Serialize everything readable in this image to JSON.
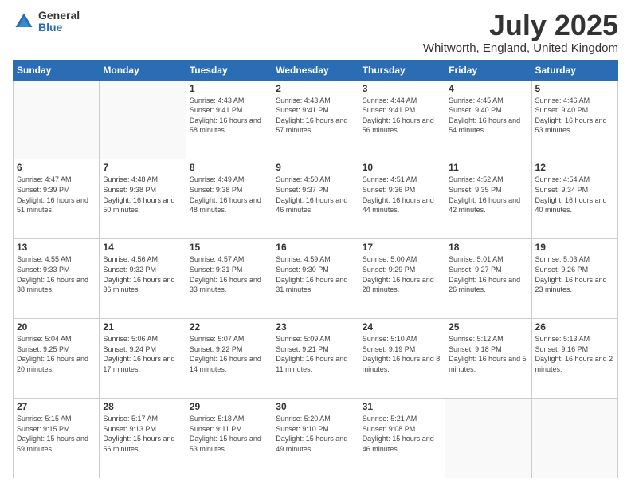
{
  "logo": {
    "general": "General",
    "blue": "Blue"
  },
  "title": "July 2025",
  "subtitle": "Whitworth, England, United Kingdom",
  "headers": [
    "Sunday",
    "Monday",
    "Tuesday",
    "Wednesday",
    "Thursday",
    "Friday",
    "Saturday"
  ],
  "weeks": [
    [
      {
        "day": "",
        "sunrise": "",
        "sunset": "",
        "daylight": ""
      },
      {
        "day": "",
        "sunrise": "",
        "sunset": "",
        "daylight": ""
      },
      {
        "day": "1",
        "sunrise": "Sunrise: 4:43 AM",
        "sunset": "Sunset: 9:41 PM",
        "daylight": "Daylight: 16 hours and 58 minutes."
      },
      {
        "day": "2",
        "sunrise": "Sunrise: 4:43 AM",
        "sunset": "Sunset: 9:41 PM",
        "daylight": "Daylight: 16 hours and 57 minutes."
      },
      {
        "day": "3",
        "sunrise": "Sunrise: 4:44 AM",
        "sunset": "Sunset: 9:41 PM",
        "daylight": "Daylight: 16 hours and 56 minutes."
      },
      {
        "day": "4",
        "sunrise": "Sunrise: 4:45 AM",
        "sunset": "Sunset: 9:40 PM",
        "daylight": "Daylight: 16 hours and 54 minutes."
      },
      {
        "day": "5",
        "sunrise": "Sunrise: 4:46 AM",
        "sunset": "Sunset: 9:40 PM",
        "daylight": "Daylight: 16 hours and 53 minutes."
      }
    ],
    [
      {
        "day": "6",
        "sunrise": "Sunrise: 4:47 AM",
        "sunset": "Sunset: 9:39 PM",
        "daylight": "Daylight: 16 hours and 51 minutes."
      },
      {
        "day": "7",
        "sunrise": "Sunrise: 4:48 AM",
        "sunset": "Sunset: 9:38 PM",
        "daylight": "Daylight: 16 hours and 50 minutes."
      },
      {
        "day": "8",
        "sunrise": "Sunrise: 4:49 AM",
        "sunset": "Sunset: 9:38 PM",
        "daylight": "Daylight: 16 hours and 48 minutes."
      },
      {
        "day": "9",
        "sunrise": "Sunrise: 4:50 AM",
        "sunset": "Sunset: 9:37 PM",
        "daylight": "Daylight: 16 hours and 46 minutes."
      },
      {
        "day": "10",
        "sunrise": "Sunrise: 4:51 AM",
        "sunset": "Sunset: 9:36 PM",
        "daylight": "Daylight: 16 hours and 44 minutes."
      },
      {
        "day": "11",
        "sunrise": "Sunrise: 4:52 AM",
        "sunset": "Sunset: 9:35 PM",
        "daylight": "Daylight: 16 hours and 42 minutes."
      },
      {
        "day": "12",
        "sunrise": "Sunrise: 4:54 AM",
        "sunset": "Sunset: 9:34 PM",
        "daylight": "Daylight: 16 hours and 40 minutes."
      }
    ],
    [
      {
        "day": "13",
        "sunrise": "Sunrise: 4:55 AM",
        "sunset": "Sunset: 9:33 PM",
        "daylight": "Daylight: 16 hours and 38 minutes."
      },
      {
        "day": "14",
        "sunrise": "Sunrise: 4:56 AM",
        "sunset": "Sunset: 9:32 PM",
        "daylight": "Daylight: 16 hours and 36 minutes."
      },
      {
        "day": "15",
        "sunrise": "Sunrise: 4:57 AM",
        "sunset": "Sunset: 9:31 PM",
        "daylight": "Daylight: 16 hours and 33 minutes."
      },
      {
        "day": "16",
        "sunrise": "Sunrise: 4:59 AM",
        "sunset": "Sunset: 9:30 PM",
        "daylight": "Daylight: 16 hours and 31 minutes."
      },
      {
        "day": "17",
        "sunrise": "Sunrise: 5:00 AM",
        "sunset": "Sunset: 9:29 PM",
        "daylight": "Daylight: 16 hours and 28 minutes."
      },
      {
        "day": "18",
        "sunrise": "Sunrise: 5:01 AM",
        "sunset": "Sunset: 9:27 PM",
        "daylight": "Daylight: 16 hours and 26 minutes."
      },
      {
        "day": "19",
        "sunrise": "Sunrise: 5:03 AM",
        "sunset": "Sunset: 9:26 PM",
        "daylight": "Daylight: 16 hours and 23 minutes."
      }
    ],
    [
      {
        "day": "20",
        "sunrise": "Sunrise: 5:04 AM",
        "sunset": "Sunset: 9:25 PM",
        "daylight": "Daylight: 16 hours and 20 minutes."
      },
      {
        "day": "21",
        "sunrise": "Sunrise: 5:06 AM",
        "sunset": "Sunset: 9:24 PM",
        "daylight": "Daylight: 16 hours and 17 minutes."
      },
      {
        "day": "22",
        "sunrise": "Sunrise: 5:07 AM",
        "sunset": "Sunset: 9:22 PM",
        "daylight": "Daylight: 16 hours and 14 minutes."
      },
      {
        "day": "23",
        "sunrise": "Sunrise: 5:09 AM",
        "sunset": "Sunset: 9:21 PM",
        "daylight": "Daylight: 16 hours and 11 minutes."
      },
      {
        "day": "24",
        "sunrise": "Sunrise: 5:10 AM",
        "sunset": "Sunset: 9:19 PM",
        "daylight": "Daylight: 16 hours and 8 minutes."
      },
      {
        "day": "25",
        "sunrise": "Sunrise: 5:12 AM",
        "sunset": "Sunset: 9:18 PM",
        "daylight": "Daylight: 16 hours and 5 minutes."
      },
      {
        "day": "26",
        "sunrise": "Sunrise: 5:13 AM",
        "sunset": "Sunset: 9:16 PM",
        "daylight": "Daylight: 16 hours and 2 minutes."
      }
    ],
    [
      {
        "day": "27",
        "sunrise": "Sunrise: 5:15 AM",
        "sunset": "Sunset: 9:15 PM",
        "daylight": "Daylight: 15 hours and 59 minutes."
      },
      {
        "day": "28",
        "sunrise": "Sunrise: 5:17 AM",
        "sunset": "Sunset: 9:13 PM",
        "daylight": "Daylight: 15 hours and 56 minutes."
      },
      {
        "day": "29",
        "sunrise": "Sunrise: 5:18 AM",
        "sunset": "Sunset: 9:11 PM",
        "daylight": "Daylight: 15 hours and 53 minutes."
      },
      {
        "day": "30",
        "sunrise": "Sunrise: 5:20 AM",
        "sunset": "Sunset: 9:10 PM",
        "daylight": "Daylight: 15 hours and 49 minutes."
      },
      {
        "day": "31",
        "sunrise": "Sunrise: 5:21 AM",
        "sunset": "Sunset: 9:08 PM",
        "daylight": "Daylight: 15 hours and 46 minutes."
      },
      {
        "day": "",
        "sunrise": "",
        "sunset": "",
        "daylight": ""
      },
      {
        "day": "",
        "sunrise": "",
        "sunset": "",
        "daylight": ""
      }
    ]
  ]
}
